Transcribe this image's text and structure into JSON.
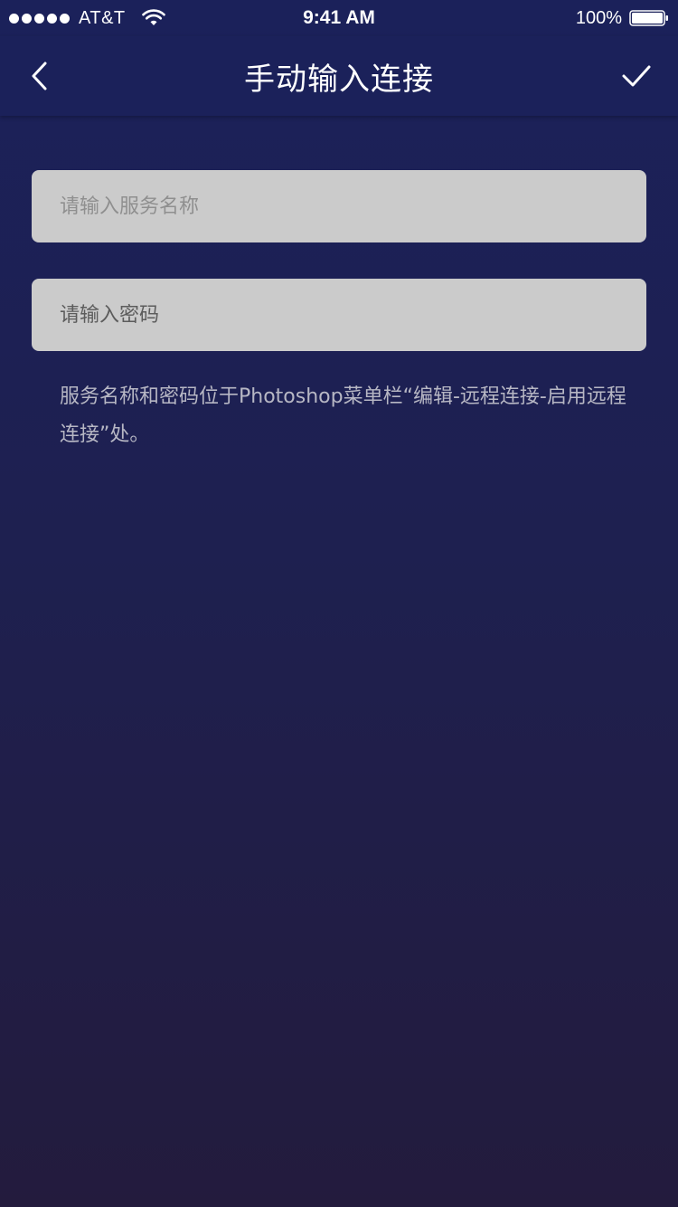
{
  "status_bar": {
    "carrier": "AT&T",
    "time": "9:41 AM",
    "battery": "100%"
  },
  "nav": {
    "title": "手动输入连接",
    "back_icon": "chevron-left-icon",
    "confirm_icon": "checkmark-icon"
  },
  "form": {
    "service_name": {
      "value": "",
      "placeholder": "请输入服务名称"
    },
    "password": {
      "value": "",
      "placeholder": "请输入密码"
    },
    "hint": "服务名称和密码位于Photoshop菜单栏“编辑-远程连接-启用远程连接”处。"
  },
  "colors": {
    "background_top": "#1b215a",
    "background_bottom": "#231b3d",
    "input_background": "#cbcbcb",
    "hint_text": "#b7b7c4"
  }
}
